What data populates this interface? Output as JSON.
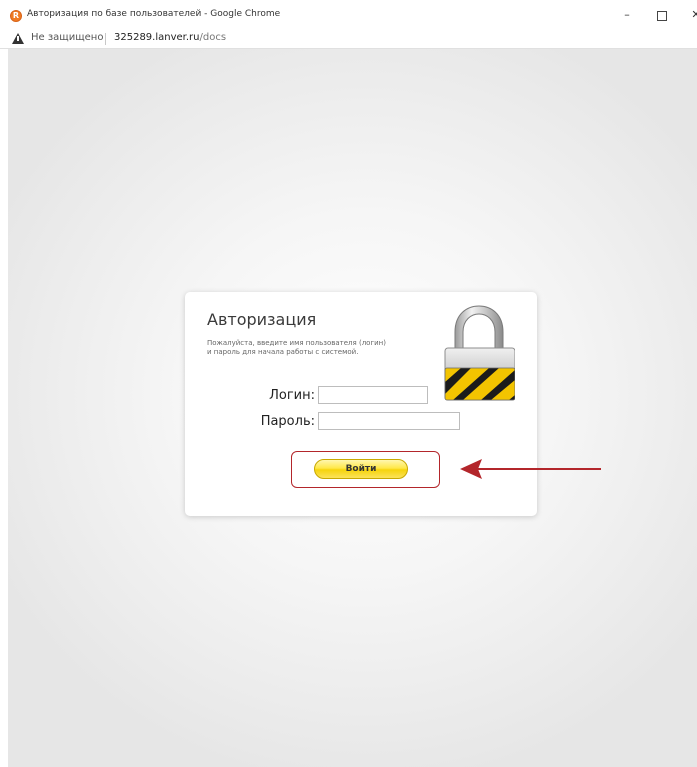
{
  "window": {
    "title": "Авторизация по базе пользователей - Google Chrome",
    "app_icon": "Ⓡ",
    "controls": [
      "–",
      "☐",
      "✕"
    ]
  },
  "address_bar": {
    "security_label": "Не защищено",
    "url_host": "325289.lanver.ru",
    "url_path": "/docs"
  },
  "login": {
    "title": "Авторизация",
    "subtitle_line1": "Пожалуйста, введите имя пользователя (логин)",
    "subtitle_line2": "и пароль для начала работы с системой.",
    "login_label": "Логин:",
    "password_label": "Пароль:",
    "login_value": "",
    "password_value": "",
    "submit_label": "Войти"
  },
  "annotation": {
    "highlight_color": "#b3262b"
  },
  "icons": {
    "app": "app-logo-icon",
    "warning": "warning-triangle-icon",
    "lock": "padlock-icon"
  }
}
